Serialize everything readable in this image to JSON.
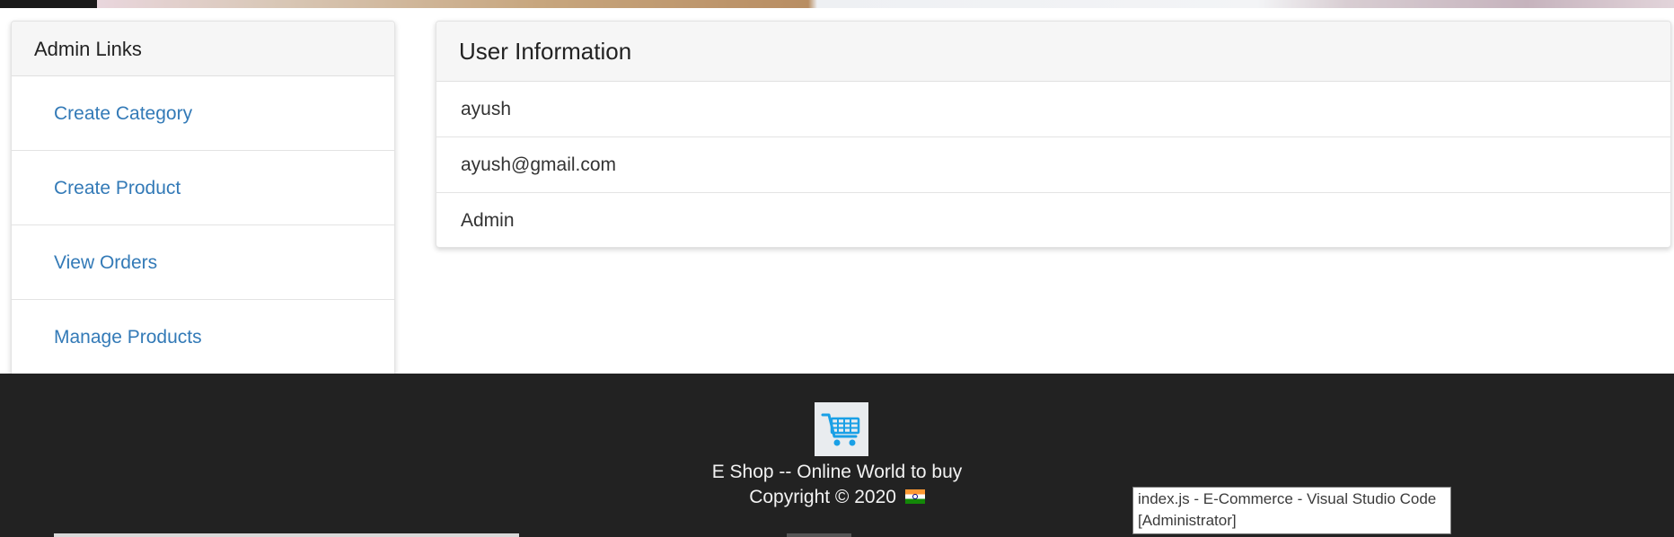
{
  "admin_links": {
    "title": "Admin Links",
    "items": [
      {
        "label": "Create Category"
      },
      {
        "label": "Create Product"
      },
      {
        "label": "View Orders"
      },
      {
        "label": "Manage Products"
      }
    ]
  },
  "user_info": {
    "title": "User Information",
    "name": "ayush",
    "email": "ayush@gmail.com",
    "role": "Admin"
  },
  "footer": {
    "logo_icon": "shopping-cart-icon",
    "tagline": "E Shop -- Online World to buy",
    "copyright": "Copyright © 2020",
    "flag_icon": "india-flag-icon"
  },
  "tooltip": {
    "text": "index.js - E-Commerce - Visual Studio Code [Administrator]"
  },
  "colors": {
    "link": "#337ab7",
    "footer_bg": "#222222",
    "cart_blue": "#1aa0e6"
  }
}
